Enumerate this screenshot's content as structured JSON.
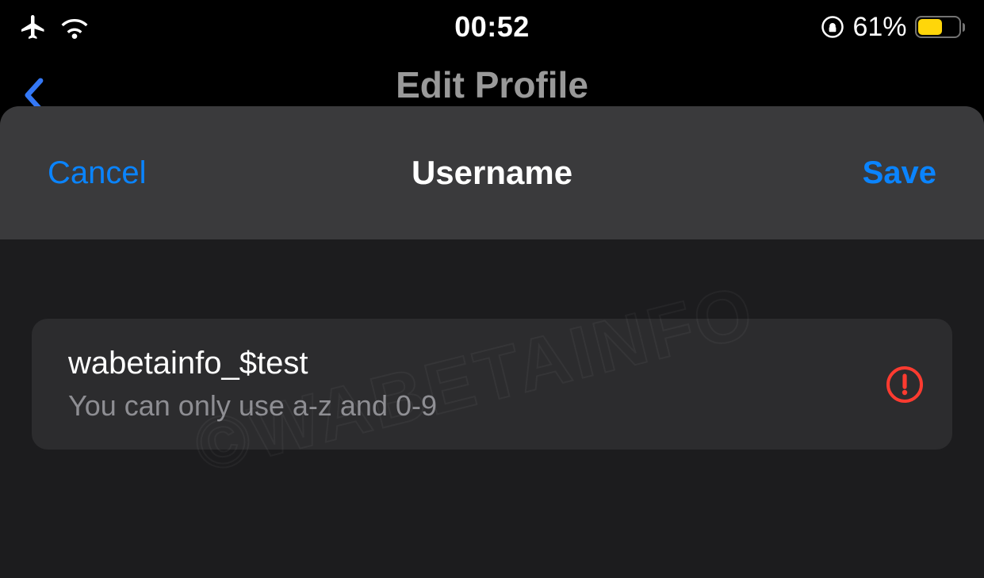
{
  "statusbar": {
    "time": "00:52",
    "battery_percent_label": "61%",
    "battery_percent": 61
  },
  "underSheet": {
    "title": "Edit Profile"
  },
  "sheet": {
    "cancel_label": "Cancel",
    "title": "Username",
    "save_label": "Save"
  },
  "usernameField": {
    "value": "wabetainfo_$test",
    "error_hint": "You can only use a-z and 0-9"
  },
  "watermark": {
    "text": "©WABETAINFO"
  },
  "colors": {
    "accent": "#0a84ff",
    "error": "#ff3b30",
    "lowPowerBattery": "#ffd60a"
  }
}
